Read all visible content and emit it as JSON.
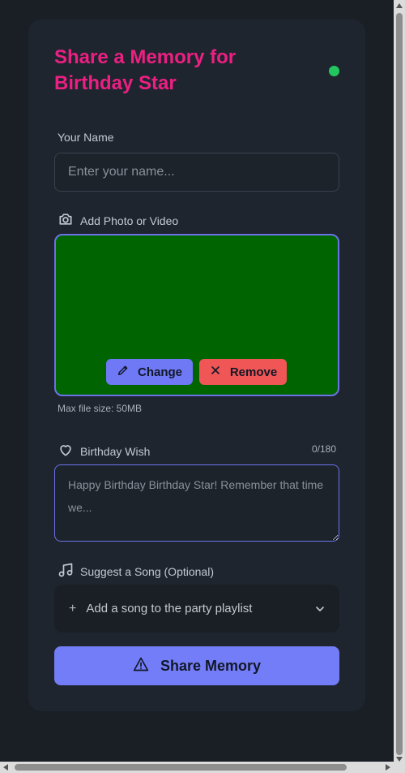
{
  "form": {
    "title": "Share a Memory for Birthday Star",
    "status_color": "#22c55e",
    "name_label": "Your Name",
    "name_placeholder": "Enter your name...",
    "name_value": "",
    "media_label": "Add Photo or Video",
    "media_icon": "camera-icon",
    "media_preview_color": "#006400",
    "change_label": "Change",
    "remove_label": "Remove",
    "max_size_hint": "Max file size: 50MB",
    "wish_label": "Birthday Wish",
    "wish_icon": "heart-icon",
    "wish_counter": "0/180",
    "wish_placeholder": "Happy Birthday Birthday Star! Remember that time we...",
    "wish_value": "",
    "song_label": "Suggest a Song (Optional)",
    "song_icon": "music-note-icon",
    "song_select_label": "Add a song to the party playlist",
    "submit_label": "Share Memory",
    "colors": {
      "accent_title": "#ec1f83",
      "accent_primary": "#747df8",
      "danger": "#f05656",
      "background": "#1a1f26",
      "card": "#1f252e"
    }
  }
}
